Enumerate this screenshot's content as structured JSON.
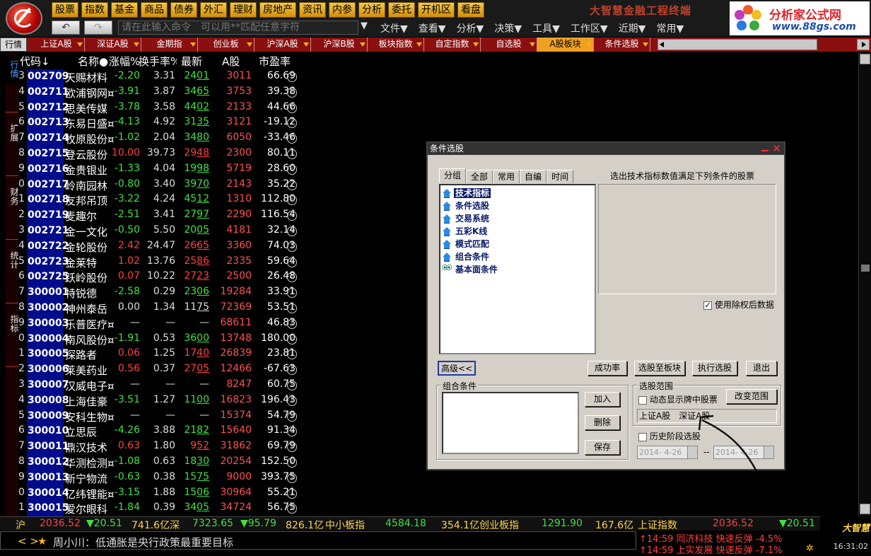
{
  "top_menu": [
    "股票",
    "指数",
    "基金",
    "商品",
    "债券",
    "外汇",
    "理财",
    "房地产",
    "资讯",
    "内参",
    "分析",
    "委托",
    "开机区",
    "看盘"
  ],
  "app_title": "大智慧金融工程终端",
  "brand": {
    "name": "分析家公式网",
    "url": "www.88gs.com"
  },
  "command": {
    "placeholder": "请在此输入命令　可以用**匹配任意字符",
    "back": "↶",
    "forward": "↷"
  },
  "func_menu": [
    "文件▼",
    "查看▼",
    "分析▼",
    "决策▼",
    "工具▼",
    "工作区▼",
    "近期▼",
    "常用▼"
  ],
  "view_label": "行情",
  "tabs": [
    {
      "label": "上证A股",
      "active": false
    },
    {
      "label": "深证A股",
      "active": false
    },
    {
      "label": "金期指",
      "active": false
    },
    {
      "label": "创业板",
      "active": false
    },
    {
      "label": "沪深A股",
      "active": false
    },
    {
      "label": "沪深B股",
      "active": false
    },
    {
      "label": "板块指数",
      "active": false
    },
    {
      "label": "自定指数",
      "active": false
    },
    {
      "label": "自选股",
      "active": false
    },
    {
      "label": "A股板块",
      "active": true
    },
    {
      "label": "条件选股",
      "active": false
    }
  ],
  "side_tabs": [
    {
      "label": "行情",
      "active": true
    },
    {
      "label": "扩展",
      "active": false
    },
    {
      "label": "财务",
      "active": false
    },
    {
      "label": "统计",
      "active": false
    },
    {
      "label": "指标",
      "active": false
    }
  ],
  "table_headers": {
    "code": "代码↓",
    "name": "名称●",
    "change": "涨幅%",
    "turnover": "换手率%",
    "last": "最新",
    "ashare": "A股",
    "pe": "市盈率"
  },
  "rows": [
    {
      "idx": "3",
      "code": "002709",
      "name": "天赐材料",
      "chg": "-2.20",
      "dir": "down",
      "turn": "3.31",
      "last_a": "24",
      "last_b": "01",
      "ashare": "3011",
      "pe": "66.69"
    },
    {
      "idx": "4",
      "code": "002711",
      "name": "欧浦钢网¤",
      "chg": "-3.91",
      "dir": "down",
      "turn": "3.87",
      "last_a": "34",
      "last_b": "65",
      "ashare": "3753",
      "pe": "39.38"
    },
    {
      "idx": "5",
      "code": "002712",
      "name": "思美传媒",
      "chg": "-3.78",
      "dir": "down",
      "turn": "3.58",
      "last_a": "44",
      "last_b": "02",
      "ashare": "2133",
      "pe": "44.66"
    },
    {
      "idx": "6",
      "code": "002713",
      "name": "东易日盛¤",
      "chg": "-4.13",
      "dir": "down",
      "turn": "4.92",
      "last_a": "31",
      "last_b": "35",
      "ashare": "3121",
      "pe": "-19.12"
    },
    {
      "idx": "7",
      "code": "002714",
      "name": "牧原股份¤",
      "chg": "-1.02",
      "dir": "down",
      "turn": "2.04",
      "last_a": "34",
      "last_b": "80",
      "ashare": "6050",
      "pe": "-33.46"
    },
    {
      "idx": "8",
      "code": "002715",
      "name": "登云股份",
      "chg": "10.00",
      "dir": "up",
      "turn": "39.73",
      "last_a": "29",
      "last_b": "48",
      "ashare": "2300",
      "pe": "80.11"
    },
    {
      "idx": "9",
      "code": "002716",
      "name": "金贵银业",
      "chg": "-1.33",
      "dir": "down",
      "turn": "4.04",
      "last_a": "19",
      "last_b": "98",
      "ashare": "5719",
      "pe": "28.60"
    },
    {
      "idx": "0",
      "code": "002717",
      "name": "岭南园林",
      "chg": "-0.80",
      "dir": "down",
      "turn": "3.40",
      "last_a": "39",
      "last_b": "70",
      "ashare": "2143",
      "pe": "35.22"
    },
    {
      "idx": "1",
      "code": "002718",
      "name": "友邦吊顶",
      "chg": "-3.22",
      "dir": "down",
      "turn": "4.24",
      "last_a": "45",
      "last_b": "12",
      "ashare": "1310",
      "pe": "112.80"
    },
    {
      "idx": "2",
      "code": "002719",
      "name": "麦趣尔",
      "chg": "-2.51",
      "dir": "down",
      "turn": "3.41",
      "last_a": "27",
      "last_b": "97",
      "ashare": "2290",
      "pe": "116.54"
    },
    {
      "idx": "3",
      "code": "002721",
      "name": "金一文化",
      "chg": "-0.50",
      "dir": "down",
      "turn": "5.50",
      "last_a": "20",
      "last_b": "05",
      "ashare": "4181",
      "pe": "32.14"
    },
    {
      "idx": "4",
      "code": "002722",
      "name": "金轮股份",
      "chg": "2.42",
      "dir": "up",
      "turn": "24.47",
      "last_a": "26",
      "last_b": "65",
      "ashare": "3360",
      "pe": "74.03"
    },
    {
      "idx": "5",
      "code": "002723",
      "name": "金莱特",
      "chg": "1.02",
      "dir": "up",
      "turn": "13.76",
      "last_a": "25",
      "last_b": "86",
      "ashare": "2335",
      "pe": "59.64"
    },
    {
      "idx": "6",
      "code": "002725",
      "name": "跃岭股份",
      "chg": "0.07",
      "dir": "up",
      "turn": "10.22",
      "last_a": "27",
      "last_b": "23",
      "ashare": "2500",
      "pe": "26.48"
    },
    {
      "idx": "7",
      "code": "300001",
      "name": "特锐德",
      "chg": "-2.58",
      "dir": "down",
      "turn": "0.29",
      "last_a": "23",
      "last_b": "06",
      "ashare": "19284",
      "pe": "33.91"
    },
    {
      "idx": "8",
      "code": "300002",
      "name": "神州泰岳",
      "chg": "0.00",
      "dir": "flat",
      "turn": "1.34",
      "last_a": "11",
      "last_b": "75",
      "ashare": "72369",
      "pe": "53.51"
    },
    {
      "idx": "9",
      "code": "300003",
      "name": "乐普医疗¤",
      "chg": "—",
      "dir": "flat",
      "turn": "—",
      "last_a": "",
      "last_b": "—",
      "ashare": "68611",
      "pe": "46.83"
    },
    {
      "idx": "0",
      "code": "300004",
      "name": "南风股份¤",
      "chg": "-1.91",
      "dir": "down",
      "turn": "0.53",
      "last_a": "36",
      "last_b": "00",
      "ashare": "13748",
      "pe": "180.00"
    },
    {
      "idx": "1",
      "code": "300005",
      "name": "探路者",
      "chg": "0.06",
      "dir": "up",
      "turn": "1.25",
      "last_a": "17",
      "last_b": "40",
      "ashare": "26839",
      "pe": "23.81"
    },
    {
      "idx": "2",
      "code": "300006",
      "name": "莱美药业",
      "chg": "0.56",
      "dir": "up",
      "turn": "0.37",
      "last_a": "27",
      "last_b": "05",
      "ashare": "12466",
      "pe": "-67.63"
    },
    {
      "idx": "3",
      "code": "300007",
      "name": "汉威电子¤",
      "chg": "—",
      "dir": "flat",
      "turn": "—",
      "last_a": "",
      "last_b": "—",
      "ashare": "8247",
      "pe": "60.75"
    },
    {
      "idx": "4",
      "code": "300008",
      "name": "上海佳豪",
      "chg": "-3.51",
      "dir": "down",
      "turn": "1.27",
      "last_a": "11",
      "last_b": "00",
      "ashare": "16823",
      "pe": "196.43"
    },
    {
      "idx": "5",
      "code": "300009",
      "name": "安科生物¤",
      "chg": "—",
      "dir": "flat",
      "turn": "—",
      "last_a": "",
      "last_b": "—",
      "ashare": "15374",
      "pe": "54.79"
    },
    {
      "idx": "6",
      "code": "300010",
      "name": "立思辰",
      "chg": "-4.26",
      "dir": "down",
      "turn": "3.88",
      "last_a": "21",
      "last_b": "82",
      "ashare": "15640",
      "pe": "91.34"
    },
    {
      "idx": "7",
      "code": "300011",
      "name": "鼎汉技术",
      "chg": "0.63",
      "dir": "up",
      "turn": "1.80",
      "last_a": "9",
      "last_b": "52",
      "ashare": "31862",
      "pe": "69.79"
    },
    {
      "idx": "8",
      "code": "300012",
      "name": "华测检测¤",
      "chg": "-1.08",
      "dir": "down",
      "turn": "0.63",
      "last_a": "18",
      "last_b": "30",
      "ashare": "20254",
      "pe": "152.50"
    },
    {
      "idx": "9",
      "code": "300013",
      "name": "新宁物流",
      "chg": "-0.63",
      "dir": "down",
      "turn": "0.38",
      "last_a": "15",
      "last_b": "75",
      "ashare": "9000",
      "pe": "393.75"
    },
    {
      "idx": "0",
      "code": "300014",
      "name": "亿纬锂能¤",
      "chg": "-3.15",
      "dir": "down",
      "turn": "1.88",
      "last_a": "15",
      "last_b": "06",
      "ashare": "30964",
      "pe": "55.21"
    },
    {
      "idx": "1",
      "code": "300015",
      "name": "爱尔眼科",
      "chg": "-1.84",
      "dir": "down",
      "turn": "0.39",
      "last_a": "34",
      "last_b": "05",
      "ashare": "34724",
      "pe": "56.75"
    }
  ],
  "dialog": {
    "title": "条件选股",
    "tabs": [
      "分组",
      "全部",
      "常用",
      "自编",
      "时间"
    ],
    "tree": [
      {
        "label": "技术指标",
        "icon": "house",
        "selected": true
      },
      {
        "label": "条件选股",
        "icon": "house",
        "selected": false
      },
      {
        "label": "交易系统",
        "icon": "house",
        "selected": false
      },
      {
        "label": "五彩K线",
        "icon": "house",
        "selected": false
      },
      {
        "label": "模式匹配",
        "icon": "house",
        "selected": false
      },
      {
        "label": "组合条件",
        "icon": "house",
        "selected": false
      },
      {
        "label": "基本面条件",
        "icon": "binoculars",
        "selected": false
      }
    ],
    "description_title": "选出技术指标数值满足下列条件的股票",
    "ex_right_label": "使用除权后数据",
    "ex_right_checked": "✓",
    "advanced_btn": "高级<<",
    "success_btn": "成功率",
    "to_block_btn": "选股至板块",
    "execute_btn": "执行选股",
    "exit_btn": "退出",
    "combo_group": "组合条件",
    "add_btn": "加入",
    "delete_btn": "删除",
    "save_btn": "保存",
    "range_group": "选股范围",
    "dynamic_label": "动态显示牌中股票",
    "change_range_btn": "改变范围",
    "range_value": "上证A股　深证A股",
    "history_label": "历史阶段选股",
    "date_from": "2014- 4-26",
    "date_sep": "--",
    "date_to": "2014- 4-26"
  },
  "ticker": {
    "sh_label": "沪",
    "sh_idx": "2036.52",
    "sh_chg": "▼20.51",
    "sh_amt": "741.6亿",
    "sz_label": "深",
    "sz_idx": "7323.65",
    "sz_chg": "▼95.79",
    "sz_amt": "826.1亿",
    "sme_label": "中小板指",
    "sme_idx": "4584.18",
    "sme_amt": "354.1亿",
    "gem_label": "创业板指",
    "gem_idx": "1291.90",
    "gem_amt": "167.6亿",
    "sse_label": "上证指数",
    "sse_idx": "2036.52",
    "sse_chg": "▼20.51"
  },
  "news": {
    "nav": "< >",
    "star": "★",
    "text": "周小川：低通胀是央行政策最重要目标"
  },
  "alerts": [
    "↑14:59 同济科技 快速反弹 -4.5%",
    "↑14:59 上实发展 快速反弹 -7.1%"
  ],
  "footer_logo": "大智慧",
  "clock": "16:31:02",
  "colors": {
    "up": "#ff4040",
    "down": "#40e040",
    "code_bg": "#000c8a",
    "tab_active": "#f0a020",
    "menu_btn": "#e8a820"
  }
}
